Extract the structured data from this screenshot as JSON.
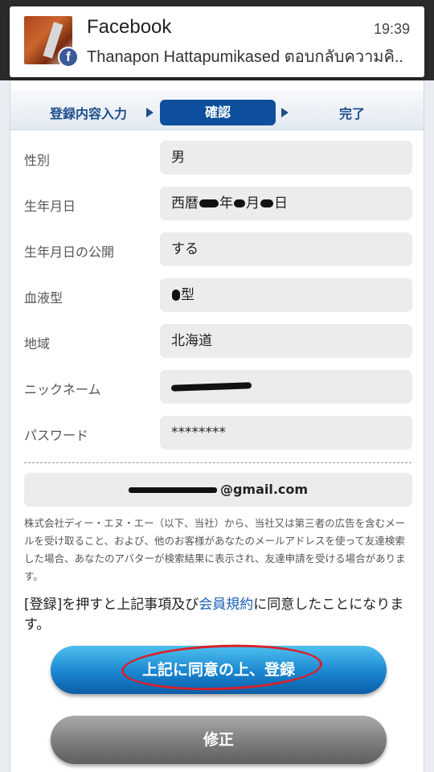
{
  "notification": {
    "app": "Facebook",
    "time": "19:39",
    "text": "Thanapon Hattapumikased ตอบกลับความคิ..",
    "badge": "f"
  },
  "steps": [
    {
      "label": "登録内容入力"
    },
    {
      "label": "確認"
    },
    {
      "label": "完了"
    }
  ],
  "fields": {
    "gender": {
      "label": "性別",
      "value": "男"
    },
    "birthdate": {
      "label": "生年月日",
      "parts": [
        "西暦",
        "年",
        "月",
        "日"
      ]
    },
    "birthdate_public": {
      "label": "生年月日の公開",
      "value": "する"
    },
    "blood_type": {
      "label": "血液型",
      "value": "型"
    },
    "region": {
      "label": "地域",
      "value": "北海道"
    },
    "nickname": {
      "label": "ニックネーム"
    },
    "password": {
      "label": "パスワード",
      "value": "********"
    }
  },
  "email": {
    "visible_suffix": "@gmail.com"
  },
  "notice": "株式会社ディー・エヌ・エー（以下、当社）から、当社又は第三者の広告を含むメールを受け取ること、および、他のお客様があなたのメールアドレスを使って友達検索した場合、あなたのアバターが検索結果に表示され、友達申請を受ける場合があります。",
  "agree": {
    "prefix": "[登録]を押すと上記事項及び",
    "link": "会員規約",
    "suffix": "に同意したことになります。"
  },
  "buttons": {
    "register": "上記に同意の上、登録",
    "edit": "修正"
  },
  "colors": {
    "accent": "#0d4f9c",
    "button_blue": "#1a86d1",
    "button_gray": "#7d7d7d",
    "annotation_red": "#d8202b",
    "facebook_blue": "#3b5998"
  }
}
